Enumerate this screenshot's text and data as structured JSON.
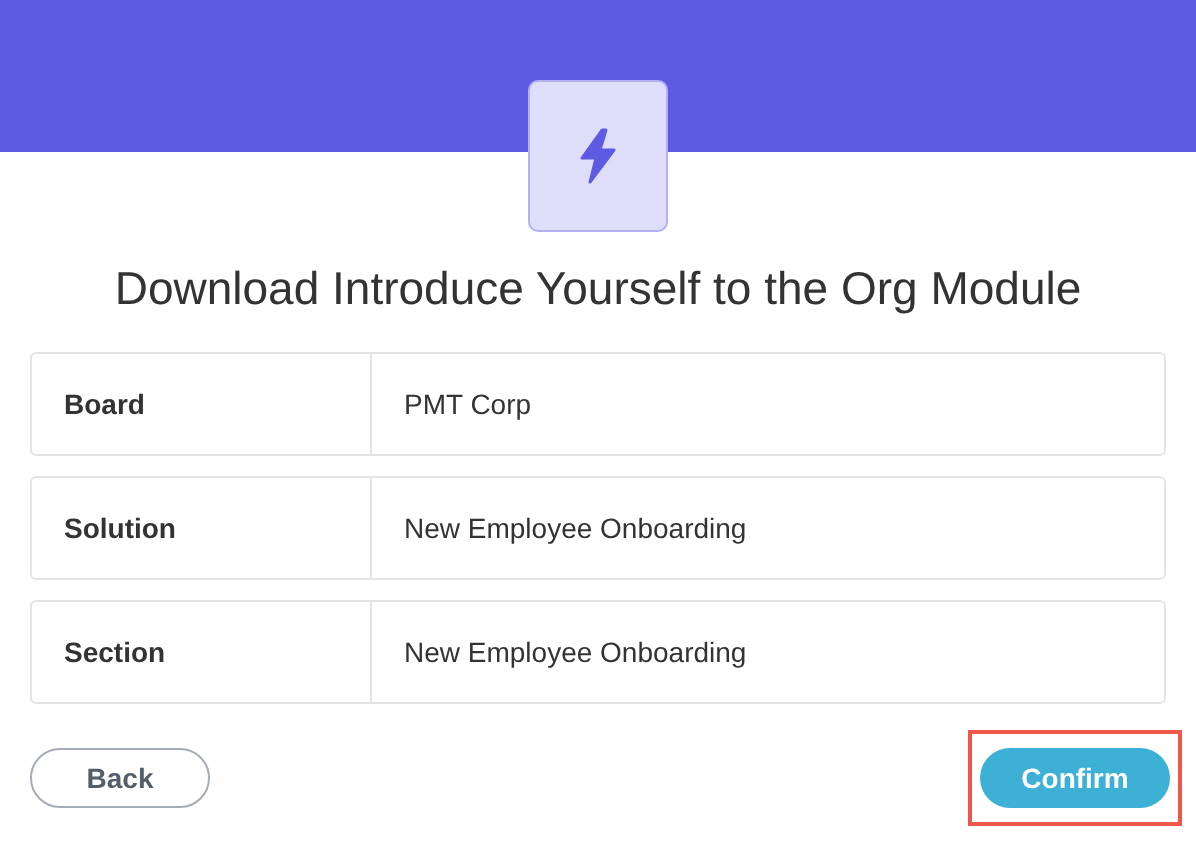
{
  "title": "Download Introduce Yourself to the Org Module",
  "details": [
    {
      "label": "Board",
      "value": "PMT Corp"
    },
    {
      "label": "Solution",
      "value": "New Employee Onboarding"
    },
    {
      "label": "Section",
      "value": "New Employee Onboarding"
    }
  ],
  "buttons": [
    {
      "label": "Back",
      "kind": "secondary",
      "highlighted": false
    },
    {
      "label": "Confirm",
      "kind": "primary",
      "highlighted": true
    }
  ]
}
